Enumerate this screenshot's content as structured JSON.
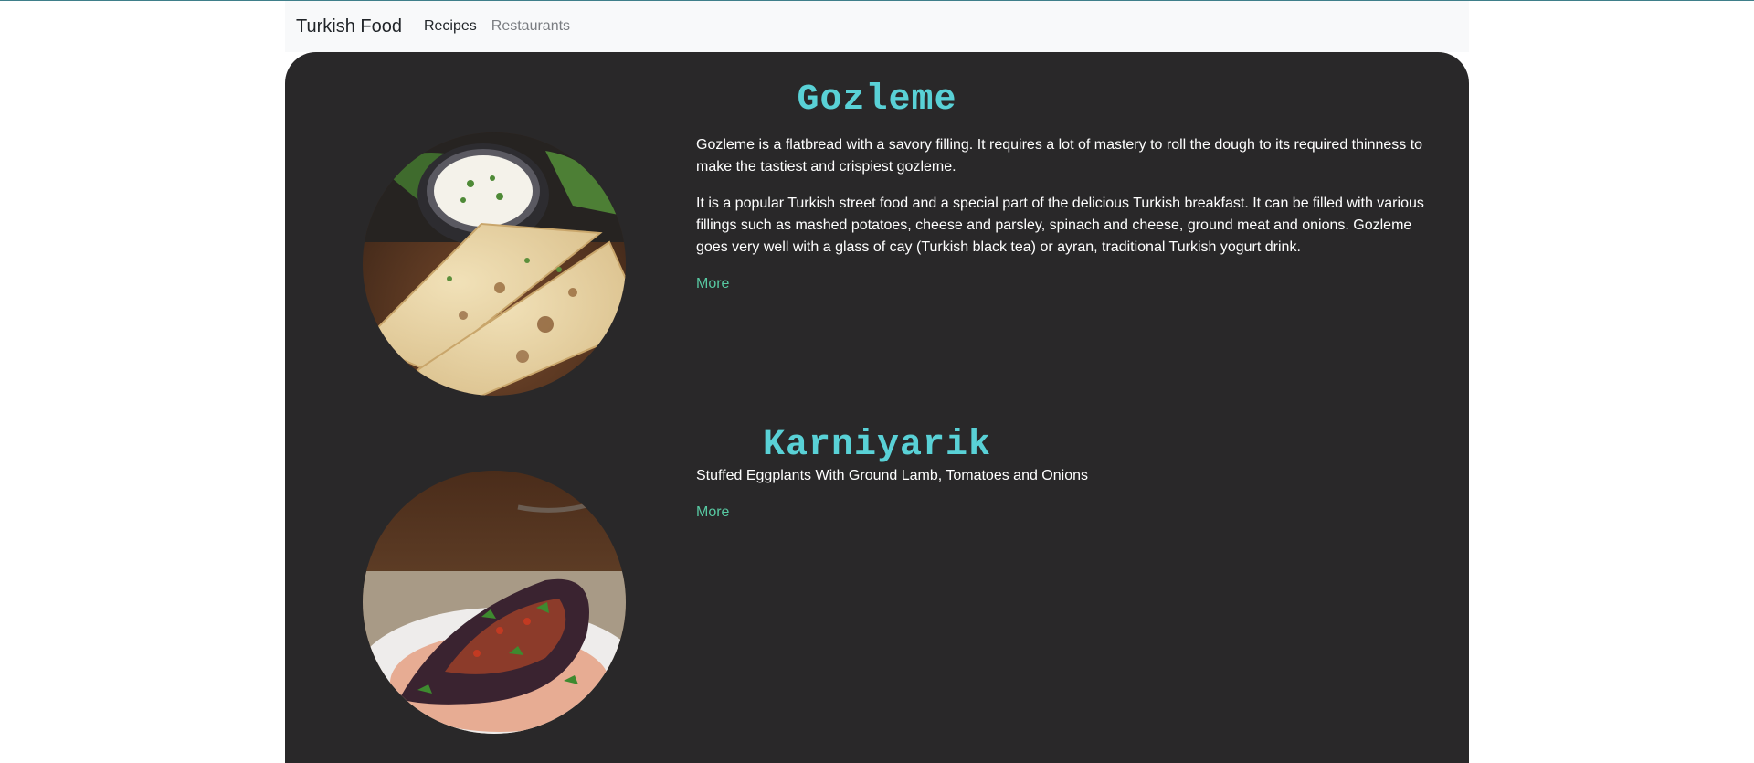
{
  "navbar": {
    "brand": "Turkish Food",
    "links": [
      {
        "label": "Recipes",
        "active": true
      },
      {
        "label": "Restaurants",
        "active": false
      }
    ]
  },
  "recipes": [
    {
      "title": "Gozleme",
      "paragraphs": [
        "Gozleme is a flatbread with a savory filling. It requires a lot of mastery to roll the dough to its required thinness to make the tastiest and crispiest gozleme.",
        "It is a popular Turkish street food and a special part of the delicious Turkish breakfast. It can be filled with various fillings such as mashed potatoes, cheese and parsley, spinach and cheese, ground meat and onions. Gozleme goes very well with a glass of cay (Turkish black tea) or ayran, traditional Turkish yogurt drink."
      ],
      "more_label": "More",
      "image": "gozleme-photo"
    },
    {
      "title": "Karniyarik",
      "paragraphs": [
        "Stuffed Eggplants With Ground Lamb, Tomatoes and Onions"
      ],
      "more_label": "More",
      "image": "karniyarik-photo"
    }
  ],
  "colors": {
    "title": "#59d1d6",
    "link": "#57c8a1",
    "panel": "#292829",
    "navbar": "#f8f9fa"
  }
}
